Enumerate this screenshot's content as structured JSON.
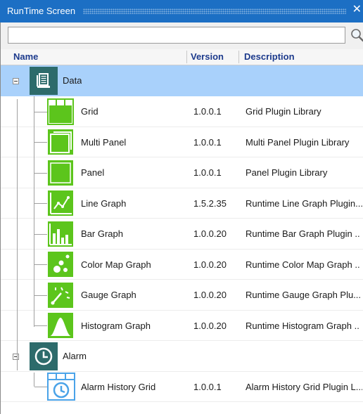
{
  "window": {
    "title": "RunTime Screen",
    "close_glyph": "✕"
  },
  "search": {
    "value": "",
    "placeholder": ""
  },
  "columns": {
    "name": "Name",
    "version": "Version",
    "description": "Description"
  },
  "colors": {
    "title_bar": "#1c6fc4",
    "selected_row": "#a9d1fb",
    "icon_green": "#5cc51c",
    "category_teal": "#2d6b6b",
    "alarm_icon_blue": "#4aa3e8"
  },
  "tree": {
    "data": {
      "label": "Data",
      "icon": "data-document-icon",
      "items": [
        {
          "name": "Grid",
          "version": "1.0.0.1",
          "description": "Grid Plugin Library",
          "icon": "grid-icon"
        },
        {
          "name": "Multi Panel",
          "version": "1.0.0.1",
          "description": "Multi Panel Plugin Library",
          "icon": "multi-panel-icon"
        },
        {
          "name": "Panel",
          "version": "1.0.0.1",
          "description": "Panel Plugin Library",
          "icon": "panel-icon"
        },
        {
          "name": "Line Graph",
          "version": "1.5.2.35",
          "description": "Runtime Line Graph Plugin...",
          "icon": "line-graph-icon"
        },
        {
          "name": "Bar Graph",
          "version": "1.0.0.20",
          "description": "Runtime Bar Graph Plugin ..",
          "icon": "bar-graph-icon"
        },
        {
          "name": "Color Map Graph",
          "version": "1.0.0.20",
          "description": "Runtime Color Map Graph ..",
          "icon": "color-map-graph-icon"
        },
        {
          "name": "Gauge Graph",
          "version": "1.0.0.20",
          "description": "Runtime Gauge Graph Plu...",
          "icon": "gauge-graph-icon"
        },
        {
          "name": "Histogram Graph",
          "version": "1.0.0.20",
          "description": "Runtime Histogram Graph ..",
          "icon": "histogram-graph-icon"
        }
      ]
    },
    "alarm": {
      "label": "Alarm",
      "icon": "clock-icon",
      "items": [
        {
          "name": "Alarm History Grid",
          "version": "1.0.0.1",
          "description": "Alarm History Grid Plugin L...",
          "icon": "alarm-history-grid-icon"
        }
      ]
    }
  }
}
